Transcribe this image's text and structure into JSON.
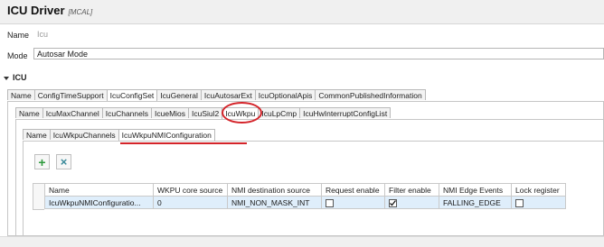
{
  "header": {
    "title": "ICU Driver",
    "subtitle": "[MCAL]"
  },
  "fields": {
    "name": {
      "label": "Name",
      "value": "Icu"
    },
    "mode": {
      "label": "Mode",
      "value": "Autosar Mode"
    }
  },
  "section": {
    "title": "ICU"
  },
  "tabs_level1": [
    "Name",
    "ConfigTimeSupport",
    "IcuConfigSet",
    "IcuGeneral",
    "IcuAutosarExt",
    "IcuOptionalApis",
    "CommonPublishedInformation"
  ],
  "tabs_level2": [
    "Name",
    "IcuMaxChannel",
    "IcuChannels",
    "IcueMios",
    "IcuSiul2",
    "IcuWkpu",
    "IcuLpCmp",
    "IcuHwInterruptConfigList"
  ],
  "tabs_level3": [
    "Name",
    "IcuWkpuChannels",
    "IcuWkpuNMIConfiguration"
  ],
  "toolbar": {
    "add": "+",
    "remove": "×"
  },
  "table": {
    "columns": [
      "Name",
      "WKPU core source",
      "NMI destination source",
      "Request enable",
      "Filter enable",
      "NMI Edge Events",
      "Lock register"
    ],
    "rows": [
      {
        "name": "IcuWkpuNMIConfiguratio...",
        "core_source": "0",
        "dest_source": "NMI_NON_MASK_INT",
        "request_enable": false,
        "filter_enable": true,
        "edge_events": "FALLING_EDGE",
        "lock_register": false
      }
    ]
  },
  "colors": {
    "annotation": "#d4242a",
    "selected_row": "#dfeefb",
    "add_icon": "#2e9a3d",
    "remove_icon": "#3a8a9a"
  }
}
